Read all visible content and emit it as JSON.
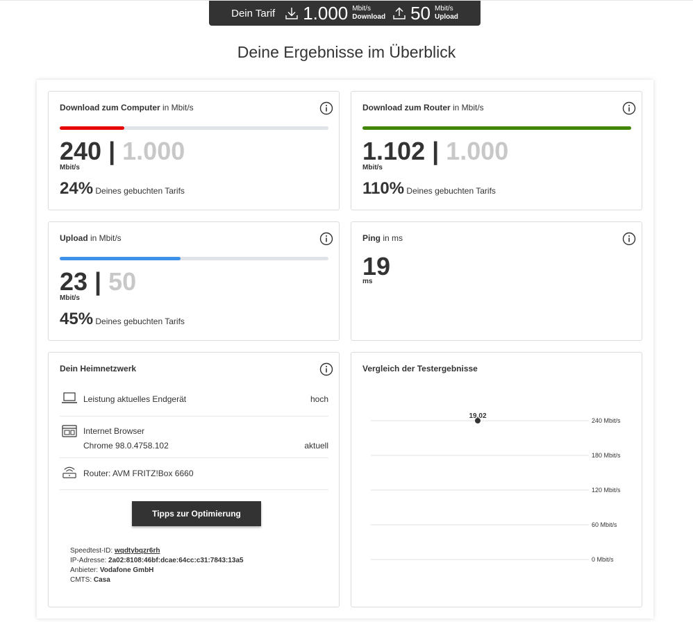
{
  "tarif": {
    "label": "Dein Tarif",
    "download_value": "1.000",
    "download_unit": "Mbit/s",
    "download_label": "Download",
    "upload_value": "50",
    "upload_unit": "Mbit/s",
    "upload_label": "Upload",
    "icons": [
      "download-icon",
      "upload-icon"
    ]
  },
  "page_title": "Deine Ergebnisse im Überblick",
  "cards": {
    "download_computer": {
      "title": "Download zum Computer",
      "title_unit": " in Mbit/s",
      "measured": "240",
      "separator": " | ",
      "booked": "1.000",
      "unit": "Mbit/s",
      "percent": "24%",
      "percent_text": " Deines gebuchten Tarifs",
      "progress": 0.24,
      "bar_color": "#e60000"
    },
    "download_router": {
      "title": "Download zum Router",
      "title_unit": " in Mbit/s",
      "measured": "1.102",
      "separator": " | ",
      "booked": "1.000",
      "unit": "Mbit/s",
      "percent": "110%",
      "percent_text": " Deines gebuchten Tarifs",
      "progress": 1.0,
      "bar_color": "#428600"
    },
    "upload": {
      "title": "Upload",
      "title_unit": " in Mbit/s",
      "measured": "23",
      "separator": " | ",
      "booked": "50",
      "unit": "Mbit/s",
      "percent": "45%",
      "percent_text": " Deines gebuchten Tarifs",
      "progress": 0.45,
      "bar_color": "#3d91e8"
    },
    "ping": {
      "title": "Ping",
      "title_unit": " in ms",
      "value": "19",
      "unit": "ms"
    },
    "heimnetz": {
      "title": "Dein Heimnetzwerk",
      "rows": [
        {
          "icon": "laptop-icon",
          "label": "Leistung aktuelles Endgerät",
          "value": "hoch"
        },
        {
          "icon": "browser-icon",
          "label": "Internet Browser",
          "sublabel": "Chrome 98.0.4758.102",
          "value": "aktuell"
        },
        {
          "icon": "router-icon",
          "label": "Router: AVM FRITZ!Box 6660",
          "value": ""
        }
      ],
      "button_label": "Tipps zur Optimierung",
      "meta": {
        "speedtest_label": "Speedtest-ID:",
        "speedtest_value": "wqdtybqzr6rh",
        "ip_label": "IP-Adresse:",
        "ip_value": "2a02:8108:46bf:dcae:64cc:c31:7843:13a5",
        "provider_label": "Anbieter:",
        "provider_value": "Vodafone GmbH",
        "cmts_label": "CMTS:",
        "cmts_value": "Casa"
      }
    },
    "vergleich": {
      "title": "Vergleich der Testergebnisse"
    }
  },
  "chart_data": {
    "type": "scatter",
    "title": "Vergleich der Testergebnisse",
    "y_ticks": [
      {
        "value": 240,
        "label": "240 Mbit/s"
      },
      {
        "value": 180,
        "label": "180 Mbit/s"
      },
      {
        "value": 120,
        "label": "120 Mbit/s"
      },
      {
        "value": 60,
        "label": "60 Mbit/s"
      },
      {
        "value": 0,
        "label": "0 Mbit/s"
      }
    ],
    "ylim": [
      0,
      240
    ],
    "points": [
      {
        "y": 240,
        "label": "19.02"
      }
    ],
    "grid": true,
    "point_color": "#333333",
    "grid_color": "#e0e0e0"
  }
}
